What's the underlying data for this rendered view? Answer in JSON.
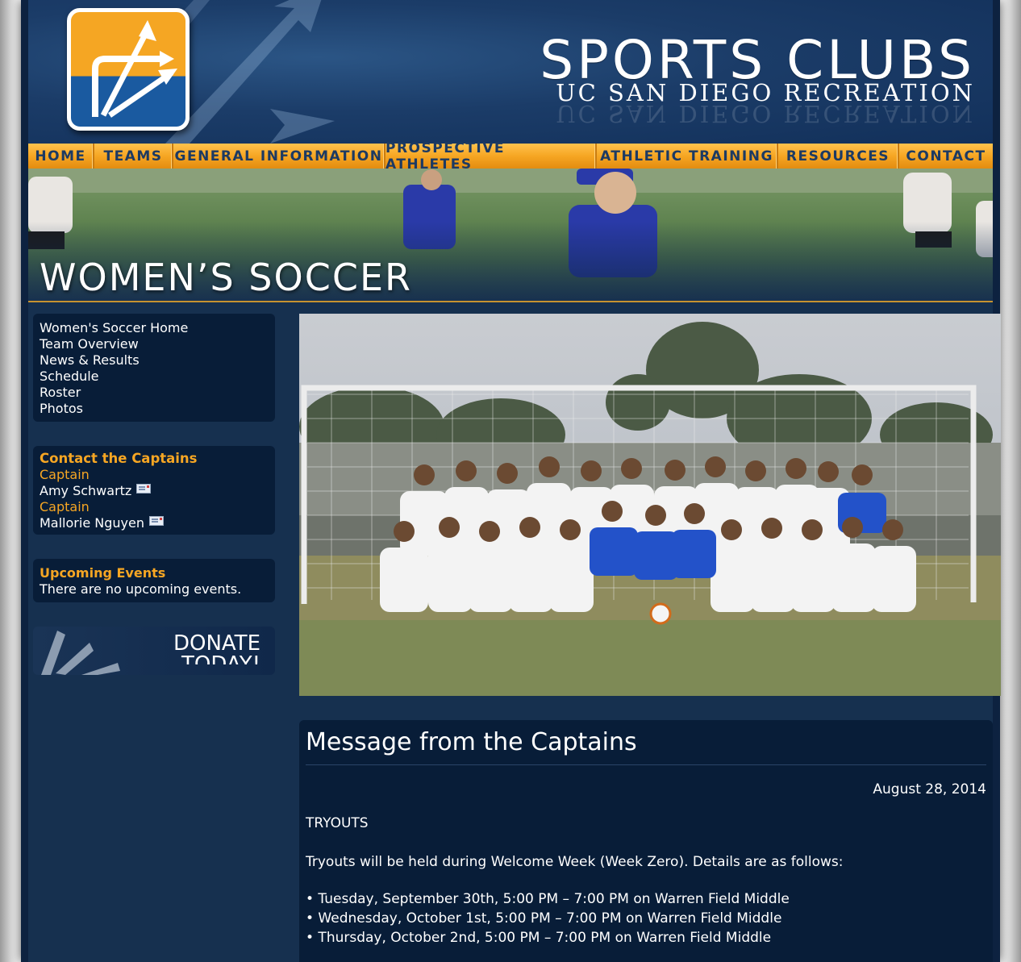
{
  "header": {
    "brand_title": "SPORTS CLUBS",
    "brand_subtitle": "UC SAN DIEGO RECREATION"
  },
  "nav": {
    "items": [
      {
        "label": "HOME"
      },
      {
        "label": "TEAMS"
      },
      {
        "label": "GENERAL INFORMATION"
      },
      {
        "label": "PROSPECTIVE ATHLETES"
      },
      {
        "label": "ATHLETIC TRAINING"
      },
      {
        "label": "RESOURCES"
      },
      {
        "label": "CONTACT"
      }
    ]
  },
  "banner": {
    "title": "WOMEN’S SOCCER"
  },
  "sidebar": {
    "links": [
      {
        "label": "Women's Soccer Home"
      },
      {
        "label": "Team Overview"
      },
      {
        "label": "News & Results"
      },
      {
        "label": "Schedule"
      },
      {
        "label": "Roster"
      },
      {
        "label": "Photos"
      }
    ],
    "captains": {
      "heading": "Contact the Captains",
      "people": [
        {
          "role": "Captain",
          "name": "Amy Schwartz"
        },
        {
          "role": "Captain",
          "name": "Mallorie Nguyen"
        }
      ]
    },
    "events": {
      "heading": "Upcoming Events",
      "text": "There are no upcoming events."
    },
    "donate": {
      "line1": "DONATE",
      "line2": "TODAY!"
    }
  },
  "content": {
    "title": "Message from the Captains",
    "date": "August 28, 2014",
    "heading": "TRYOUTS",
    "intro": "Tryouts will be held during Welcome Week (Week Zero). Details are as follows:",
    "bullets": [
      "• Tuesday, September 30th, 5:00 PM – 7:00 PM on Warren Field Middle",
      "• Wednesday, October 1st, 5:00 PM – 7:00 PM on Warren Field Middle",
      "• Thursday, October 2nd, 5:00 PM – 7:00 PM on Warren Field Middle"
    ]
  },
  "colors": {
    "accent_orange": "#f6a623",
    "page_navy": "#16304f",
    "box_navy": "#081d38",
    "nav_text": "#1c3a63"
  }
}
